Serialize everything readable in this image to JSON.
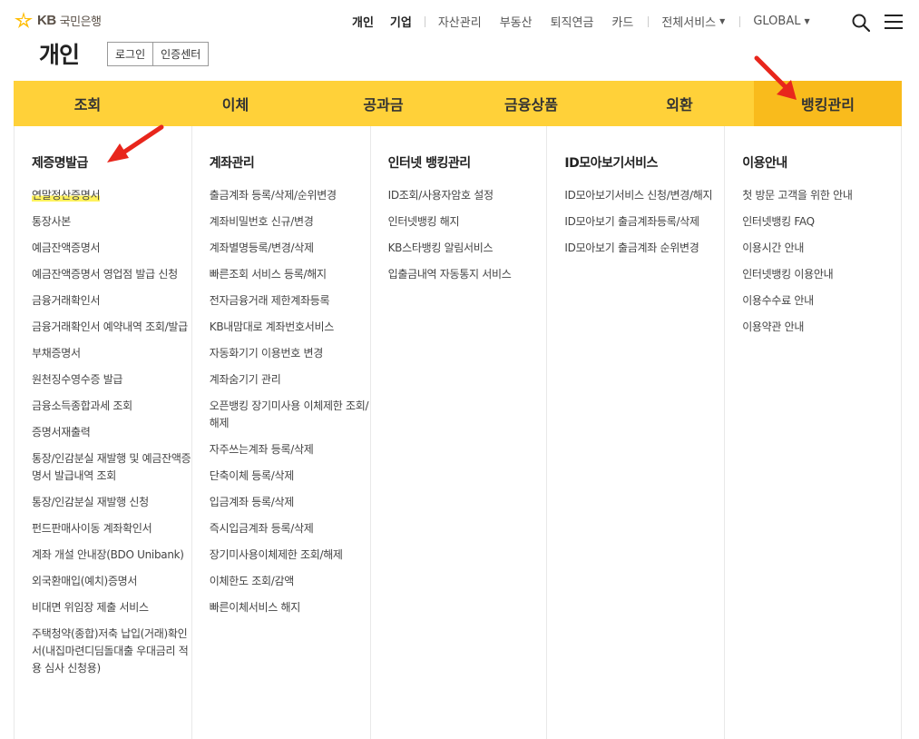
{
  "brand": {
    "kb": "KB",
    "bank": "국민은행",
    "icon": "kb-star-logo"
  },
  "topnav": {
    "personal": "개인",
    "corporate": "기업",
    "asset": "자산관리",
    "realestate": "부동산",
    "pension": "퇴직연금",
    "card": "카드",
    "all_services": "전체서비스",
    "global": "GLOBAL"
  },
  "page": {
    "title": "개인",
    "login": "로그인",
    "cert_center": "인증센터"
  },
  "gnb": {
    "tabs": [
      {
        "label": "조회"
      },
      {
        "label": "이체"
      },
      {
        "label": "공과금"
      },
      {
        "label": "금융상품"
      },
      {
        "label": "외환"
      },
      {
        "label": "뱅킹관리"
      }
    ],
    "active_color": "#f9bb1c",
    "bar_color": "#ffd139"
  },
  "mega": {
    "col1": {
      "title": "제증명발급",
      "items": [
        "연말정산증명서",
        "통장사본",
        "예금잔액증명서",
        "예금잔액증명서 영업점 발급 신청",
        "금융거래확인서",
        "금융거래확인서 예약내역 조회/발급",
        "부채증명서",
        "원천징수영수증 발급",
        "금융소득종합과세 조회",
        "증명서재출력",
        "통장/인감분실 재발행 및 예금잔액증명서 발급내역 조회",
        "통장/인감분실 재발행 신청",
        "펀드판매사이동 계좌확인서",
        "계좌 개설 안내장(BDO Unibank)",
        "외국환매입(예치)증명서",
        "비대면 위임장 제출 서비스",
        "주택청약(종합)저축 납입(거래)확인서(내집마련디딤돌대출 우대금리 적용 심사 신청용)"
      ]
    },
    "col2": {
      "title": "계좌관리",
      "items": [
        "출금계좌 등록/삭제/순위변경",
        "계좌비밀번호 신규/변경",
        "계좌별명등록/변경/삭제",
        "빠른조회 서비스 등록/해지",
        "전자금융거래 제한계좌등록",
        "KB내맘대로 계좌번호서비스",
        "자동화기기 이용번호 변경",
        "계좌숨기기 관리",
        "오픈뱅킹 장기미사용 이체제한 조회/해제",
        "자주쓰는계좌 등록/삭제",
        "단축이체 등록/삭제",
        "입금계좌 등록/삭제",
        "즉시입금계좌 등록/삭제",
        "장기미사용이체제한 조회/해제",
        "이체한도 조회/감액",
        "빠른이체서비스 해지"
      ]
    },
    "col3": {
      "title": "인터넷 뱅킹관리",
      "items": [
        "ID조회/사용자암호 설정",
        "인터넷뱅킹 해지",
        "KB스타뱅킹 알림서비스",
        "입출금내역 자동통지 서비스"
      ]
    },
    "col4": {
      "title": "ID모아보기서비스",
      "items": [
        "ID모아보기서비스 신청/변경/해지",
        "ID모아보기 출금계좌등록/삭제",
        "ID모아보기 출금계좌 순위변경"
      ]
    },
    "col5": {
      "title": "이용안내",
      "items": [
        "첫 방문 고객을 위한 안내",
        "인터넷뱅킹 FAQ",
        "이용시간 안내",
        "인터넷뱅킹 이용안내",
        "이용수수료 안내",
        "이용약관 안내"
      ]
    }
  },
  "highlight_color": "#fff25c",
  "arrow_color": "#e8261c"
}
